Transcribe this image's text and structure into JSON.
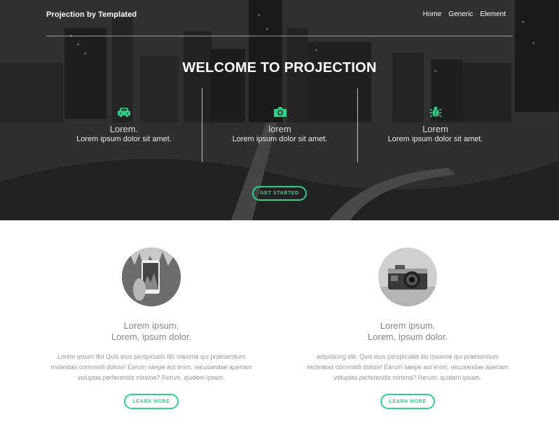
{
  "header": {
    "brand": "Projection by Templated",
    "nav": [
      "Home",
      "Generic",
      "Element"
    ]
  },
  "hero": {
    "title": "WELCOME TO PROJECTION",
    "features": [
      {
        "icon": "car-icon",
        "heading": "Lorem.",
        "text": "Lorem ipsum dolor sit amet."
      },
      {
        "icon": "camera-icon",
        "heading": "lorem",
        "text": "Lorem ipsum dolor sit amet."
      },
      {
        "icon": "bug-icon",
        "heading": "Lorem",
        "text": "Lorem ipsum dolor sit amet."
      }
    ],
    "button": "GET STARTED"
  },
  "columns": [
    {
      "image": "smartphone-photo",
      "title1": "Lorem ipsum.",
      "title2": "Lorem, ipsum dolor.",
      "text": "Lorem ipsum dol Quis eius perspiciatis illo maxime qui praesentium molestias commodi dolore! Earum saepe aut enim, recusandae aperiam voluptas perferendis minima? Rerum, quidem ipsam.",
      "button": "LEARN MORE"
    },
    {
      "image": "vintage-camera-photo",
      "title1": "Lorem ipsum.",
      "title2": "Lorem, ipsum dolor.",
      "text": "adipisicing elit. Quis eius perspiciatis illo maxime qui praesentium molestias commodi dolore! Earum saepe aut enim, recusandae aperiam voluptas perferendis minima? Rerum, quidem ipsam.",
      "button": "LEARN MORE"
    }
  ],
  "colors": {
    "accent": "#2fd28b",
    "hero_bg": "#2e2e2e"
  }
}
